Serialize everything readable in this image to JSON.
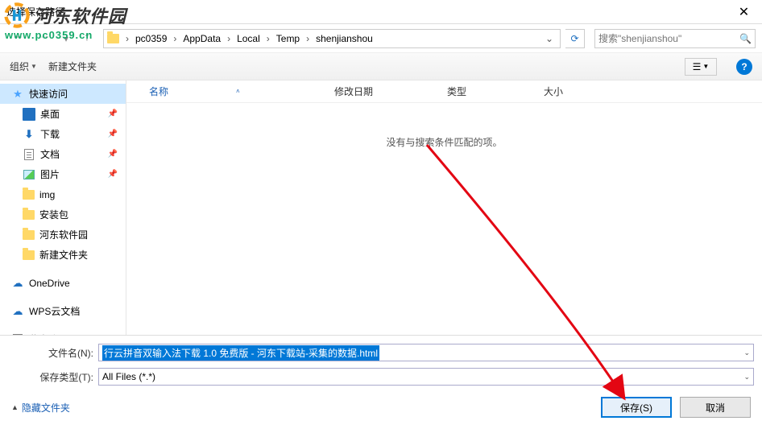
{
  "title": "选择保存路径",
  "watermark": {
    "brand": "河东软件园",
    "url": "www.pc0359.cn"
  },
  "nav": {
    "crumbs": [
      "",
      "pc0359",
      "AppData",
      "Local",
      "Temp",
      "shenjianshou"
    ],
    "search_placeholder": "搜索\"shenjianshou\""
  },
  "toolbar": {
    "organize": "组织",
    "newfolder": "新建文件夹"
  },
  "sidebar": {
    "quick": "快速访问",
    "desktop": "桌面",
    "download": "下载",
    "docs": "文档",
    "pics": "图片",
    "img": "img",
    "pkg": "安装包",
    "hd": "河东软件园",
    "newf": "新建文件夹",
    "onedrive": "OneDrive",
    "wps": "WPS云文档",
    "thispc": "此电脑"
  },
  "cols": {
    "name": "名称",
    "date": "修改日期",
    "type": "类型",
    "size": "大小"
  },
  "empty": "没有与搜索条件匹配的项。",
  "filename_label": "文件名(N):",
  "filename_value": "行云拼音双输入法下载 1.0 免费版 - 河东下载站-采集的数据.html",
  "filetype_label": "保存类型(T):",
  "filetype_value": "All Files (*.*)",
  "hide_folders": "隐藏文件夹",
  "save": "保存(S)",
  "cancel": "取消"
}
